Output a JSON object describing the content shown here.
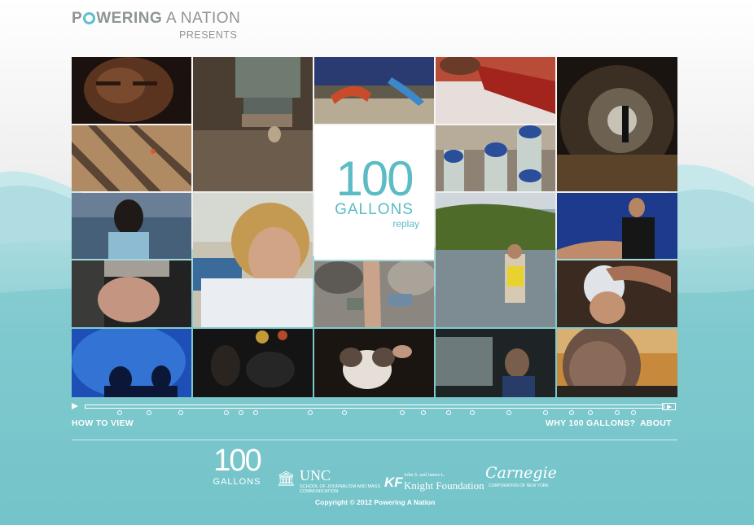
{
  "header": {
    "brand_part1": "P",
    "brand_part2": "WERING",
    "brand_part3": " A NATION",
    "presents": "PRESENTS"
  },
  "center_logo": {
    "number": "100",
    "word": "GALLONS",
    "sub": "replay"
  },
  "tiles": [
    {
      "name": "tile-boy-face",
      "icon": "photo"
    },
    {
      "name": "tile-dripping-faucet",
      "icon": "photo"
    },
    {
      "name": "tile-water-slides",
      "icon": "photo"
    },
    {
      "name": "tile-hand-red-object",
      "icon": "photo"
    },
    {
      "name": "tile-tunnel-figure",
      "icon": "photo"
    },
    {
      "name": "tile-beach-shadows",
      "icon": "photo"
    },
    {
      "name": "tile-bottle-caps",
      "icon": "photo"
    },
    {
      "name": "tile-child-looking-at-water",
      "icon": "photo"
    },
    {
      "name": "tile-woman-crying",
      "icon": "photo"
    },
    {
      "name": "tile-girl-in-lake",
      "icon": "photo"
    },
    {
      "name": "tile-man-blue-shirt",
      "icon": "photo"
    },
    {
      "name": "tile-newborn-baby",
      "icon": "photo"
    },
    {
      "name": "tile-child-rock-water",
      "icon": "photo"
    },
    {
      "name": "tile-hair-washing",
      "icon": "photo"
    },
    {
      "name": "tile-aquarium-silhouettes",
      "icon": "photo"
    },
    {
      "name": "tile-night-lights",
      "icon": "photo"
    },
    {
      "name": "tile-kitten",
      "icon": "photo"
    },
    {
      "name": "tile-boy-looking-up",
      "icon": "photo"
    },
    {
      "name": "tile-old-man-portrait",
      "icon": "photo"
    }
  ],
  "timeline": {
    "marker_count": 20
  },
  "nav": {
    "how_to_view": "HOW TO VIEW",
    "why": "WHY 100 GALLONS?",
    "about": "ABOUT"
  },
  "footer": {
    "logo_number": "100",
    "logo_word": "GALLONS",
    "unc_big": "UNC",
    "unc_small": "SCHOOL OF JOURNALISM AND MASS COMMUNICATION",
    "knight_small": "John S. and James L.",
    "knight_big": "Knight Foundation",
    "carnegie_sig": "Carnegie",
    "carnegie_small": "CORPORATION OF NEW YORK",
    "copyright": "Copyright © 2012 Powering A Nation"
  },
  "colors": {
    "accent": "#5bbcc6",
    "teal_bg": "#78c5cb",
    "header_gray": "#8f9496"
  }
}
